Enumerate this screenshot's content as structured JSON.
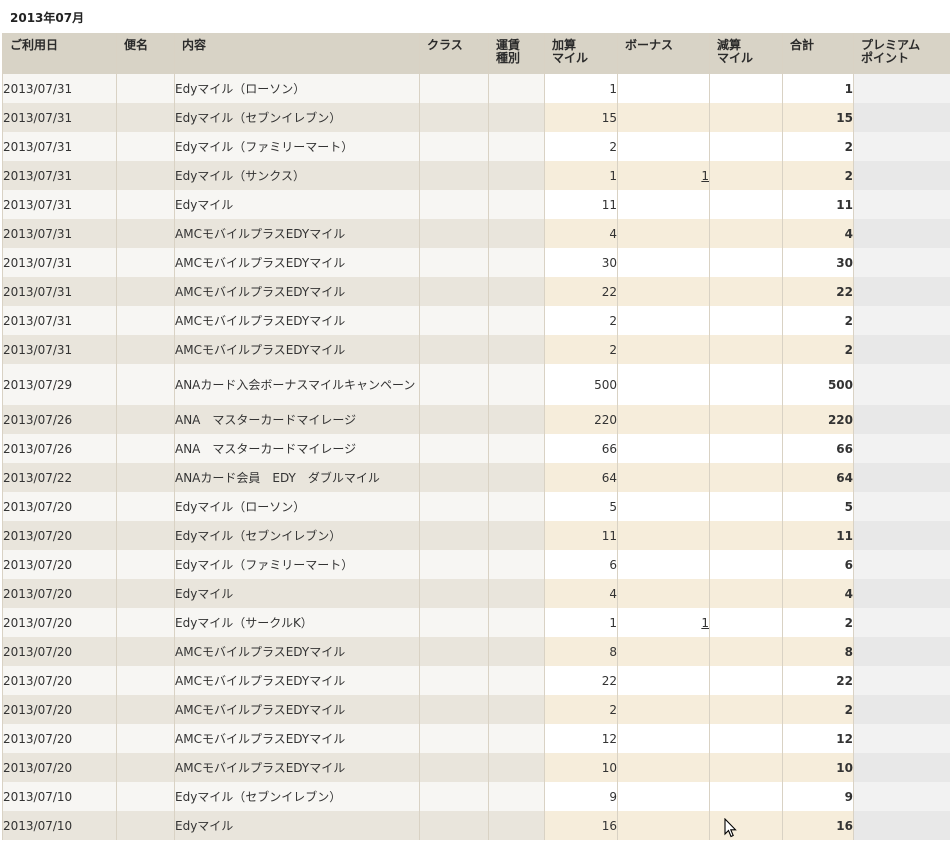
{
  "month_title": "2013年07月",
  "columns": {
    "date": "ご利用日",
    "flight": "便名",
    "content": "内容",
    "class": "クラス",
    "fare_type": "運賃\n種別",
    "plus_miles": "加算\nマイル",
    "bonus": "ボーナス",
    "minus_miles": "減算\nマイル",
    "total": "合計",
    "premium_points": "プレミアム\nポイント"
  },
  "rows": [
    {
      "date": "2013/07/31",
      "content": "Edyマイル（ローソン）",
      "plus": "1",
      "bonus": "",
      "total": "1"
    },
    {
      "date": "2013/07/31",
      "content": "Edyマイル（セブンイレブン）",
      "plus": "15",
      "bonus": "",
      "total": "15"
    },
    {
      "date": "2013/07/31",
      "content": "Edyマイル（ファミリーマート）",
      "plus": "2",
      "bonus": "",
      "total": "2"
    },
    {
      "date": "2013/07/31",
      "content": "Edyマイル（サンクス）",
      "plus": "1",
      "bonus": "1",
      "total": "2"
    },
    {
      "date": "2013/07/31",
      "content": "Edyマイル",
      "plus": "11",
      "bonus": "",
      "total": "11"
    },
    {
      "date": "2013/07/31",
      "content": "AMCモバイルプラスEDYマイル",
      "plus": "4",
      "bonus": "",
      "total": "4"
    },
    {
      "date": "2013/07/31",
      "content": "AMCモバイルプラスEDYマイル",
      "plus": "30",
      "bonus": "",
      "total": "30"
    },
    {
      "date": "2013/07/31",
      "content": "AMCモバイルプラスEDYマイル",
      "plus": "22",
      "bonus": "",
      "total": "22"
    },
    {
      "date": "2013/07/31",
      "content": "AMCモバイルプラスEDYマイル",
      "plus": "2",
      "bonus": "",
      "total": "2"
    },
    {
      "date": "2013/07/31",
      "content": "AMCモバイルプラスEDYマイル",
      "plus": "2",
      "bonus": "",
      "total": "2"
    },
    {
      "date": "2013/07/29",
      "content": "ANAカード入会ボーナスマイルキャンペーン",
      "plus": "500",
      "bonus": "",
      "total": "500"
    },
    {
      "date": "2013/07/26",
      "content": "ANA　マスターカードマイレージ",
      "plus": "220",
      "bonus": "",
      "total": "220"
    },
    {
      "date": "2013/07/26",
      "content": "ANA　マスターカードマイレージ",
      "plus": "66",
      "bonus": "",
      "total": "66"
    },
    {
      "date": "2013/07/22",
      "content": "ANAカード会員　EDY　ダブルマイル",
      "plus": "64",
      "bonus": "",
      "total": "64"
    },
    {
      "date": "2013/07/20",
      "content": "Edyマイル（ローソン）",
      "plus": "5",
      "bonus": "",
      "total": "5"
    },
    {
      "date": "2013/07/20",
      "content": "Edyマイル（セブンイレブン）",
      "plus": "11",
      "bonus": "",
      "total": "11"
    },
    {
      "date": "2013/07/20",
      "content": "Edyマイル（ファミリーマート）",
      "plus": "6",
      "bonus": "",
      "total": "6"
    },
    {
      "date": "2013/07/20",
      "content": "Edyマイル",
      "plus": "4",
      "bonus": "",
      "total": "4"
    },
    {
      "date": "2013/07/20",
      "content": "Edyマイル（サークルK）",
      "plus": "1",
      "bonus": "1",
      "total": "2"
    },
    {
      "date": "2013/07/20",
      "content": "AMCモバイルプラスEDYマイル",
      "plus": "8",
      "bonus": "",
      "total": "8"
    },
    {
      "date": "2013/07/20",
      "content": "AMCモバイルプラスEDYマイル",
      "plus": "22",
      "bonus": "",
      "total": "22"
    },
    {
      "date": "2013/07/20",
      "content": "AMCモバイルプラスEDYマイル",
      "plus": "2",
      "bonus": "",
      "total": "2"
    },
    {
      "date": "2013/07/20",
      "content": "AMCモバイルプラスEDYマイル",
      "plus": "12",
      "bonus": "",
      "total": "12"
    },
    {
      "date": "2013/07/20",
      "content": "AMCモバイルプラスEDYマイル",
      "plus": "10",
      "bonus": "",
      "total": "10"
    },
    {
      "date": "2013/07/10",
      "content": "Edyマイル（セブンイレブン）",
      "plus": "9",
      "bonus": "",
      "total": "9"
    },
    {
      "date": "2013/07/10",
      "content": "Edyマイル",
      "plus": "16",
      "bonus": "",
      "total": "16"
    }
  ],
  "icons": {
    "cursor": "mouse-pointer-icon"
  },
  "colors": {
    "header_bg": "#d8d3c6",
    "row_even": "#e9e5dc",
    "mile_even": "#f6eddb"
  }
}
